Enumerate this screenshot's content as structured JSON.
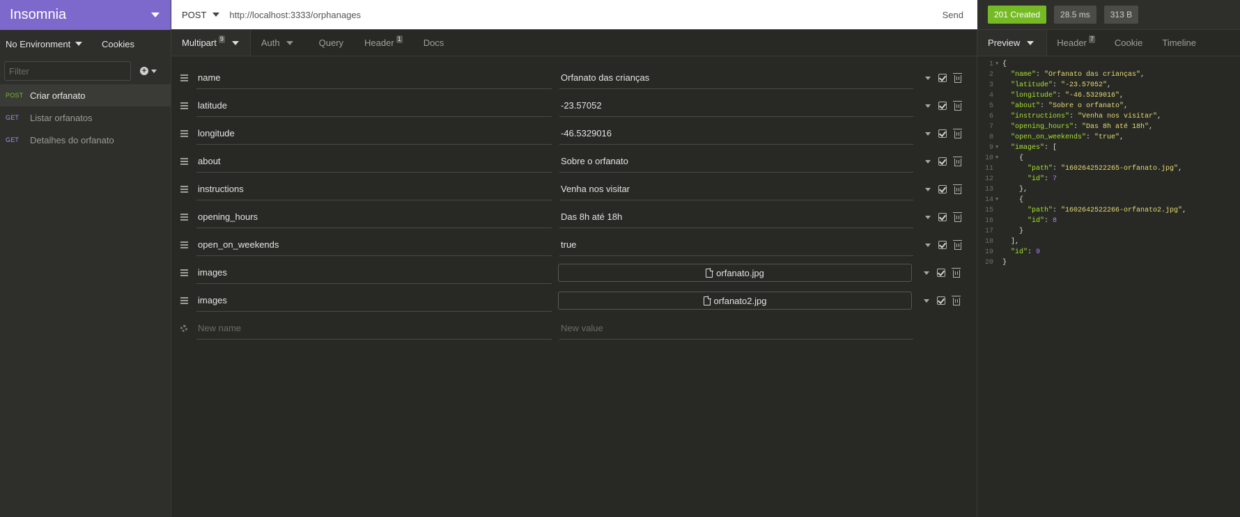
{
  "sidebar": {
    "workspace": "Insomnia",
    "environment": "No Environment",
    "cookies": "Cookies",
    "filter_placeholder": "Filter",
    "requests": [
      {
        "method": "POST",
        "name": "Criar orfanato",
        "active": true
      },
      {
        "method": "GET",
        "name": "Listar orfanatos",
        "active": false
      },
      {
        "method": "GET",
        "name": "Detalhes do orfanato",
        "active": false
      }
    ]
  },
  "urlbar": {
    "method": "POST",
    "url": "http://localhost:3333/orphanages",
    "send": "Send"
  },
  "request_tabs": {
    "body": {
      "label": "Multipart",
      "count": "9"
    },
    "auth": {
      "label": "Auth"
    },
    "query": {
      "label": "Query"
    },
    "header": {
      "label": "Header",
      "count": "1"
    },
    "docs": {
      "label": "Docs"
    }
  },
  "params": [
    {
      "name": "name",
      "value": "Orfanato das crianças"
    },
    {
      "name": "latitude",
      "value": "-23.57052"
    },
    {
      "name": "longitude",
      "value": "-46.5329016"
    },
    {
      "name": "about",
      "value": "Sobre o orfanato"
    },
    {
      "name": "instructions",
      "value": "Venha nos visitar"
    },
    {
      "name": "opening_hours",
      "value": "Das 8h até 18h"
    },
    {
      "name": "open_on_weekends",
      "value": "true"
    },
    {
      "name": "images",
      "file": "orfanato.jpg"
    },
    {
      "name": "images",
      "file": "orfanato2.jpg"
    }
  ],
  "new_param": {
    "name_placeholder": "New name",
    "value_placeholder": "New value"
  },
  "response": {
    "status": "201 Created",
    "time": "28.5 ms",
    "size": "313 B",
    "status_color": "#75ba24",
    "tabs": {
      "preview": {
        "label": "Preview"
      },
      "header": {
        "label": "Header",
        "count": "7"
      },
      "cookie": {
        "label": "Cookie"
      },
      "timeline": {
        "label": "Timeline"
      }
    },
    "body_lines": [
      {
        "n": "1",
        "fold": true,
        "indent": 0,
        "tokens": [
          [
            "pun",
            "{"
          ]
        ]
      },
      {
        "n": "2",
        "indent": 1,
        "tokens": [
          [
            "key",
            "\"name\""
          ],
          [
            "pun",
            ": "
          ],
          [
            "str",
            "\"Orfanato das crianças\""
          ],
          [
            "pun",
            ","
          ]
        ]
      },
      {
        "n": "3",
        "indent": 1,
        "tokens": [
          [
            "key",
            "\"latitude\""
          ],
          [
            "pun",
            ": "
          ],
          [
            "str",
            "\"-23.57052\""
          ],
          [
            "pun",
            ","
          ]
        ]
      },
      {
        "n": "4",
        "indent": 1,
        "tokens": [
          [
            "key",
            "\"longitude\""
          ],
          [
            "pun",
            ": "
          ],
          [
            "str",
            "\"-46.5329016\""
          ],
          [
            "pun",
            ","
          ]
        ]
      },
      {
        "n": "5",
        "indent": 1,
        "tokens": [
          [
            "key",
            "\"about\""
          ],
          [
            "pun",
            ": "
          ],
          [
            "str",
            "\"Sobre o orfanato\""
          ],
          [
            "pun",
            ","
          ]
        ]
      },
      {
        "n": "6",
        "indent": 1,
        "tokens": [
          [
            "key",
            "\"instructions\""
          ],
          [
            "pun",
            ": "
          ],
          [
            "str",
            "\"Venha nos visitar\""
          ],
          [
            "pun",
            ","
          ]
        ]
      },
      {
        "n": "7",
        "indent": 1,
        "tokens": [
          [
            "key",
            "\"opening_hours\""
          ],
          [
            "pun",
            ": "
          ],
          [
            "str",
            "\"Das 8h até 18h\""
          ],
          [
            "pun",
            ","
          ]
        ]
      },
      {
        "n": "8",
        "indent": 1,
        "tokens": [
          [
            "key",
            "\"open_on_weekends\""
          ],
          [
            "pun",
            ": "
          ],
          [
            "str",
            "\"true\""
          ],
          [
            "pun",
            ","
          ]
        ]
      },
      {
        "n": "9",
        "fold": true,
        "indent": 1,
        "tokens": [
          [
            "key",
            "\"images\""
          ],
          [
            "pun",
            ": ["
          ]
        ]
      },
      {
        "n": "10",
        "fold": true,
        "indent": 2,
        "tokens": [
          [
            "pun",
            "{"
          ]
        ]
      },
      {
        "n": "11",
        "indent": 3,
        "tokens": [
          [
            "key",
            "\"path\""
          ],
          [
            "pun",
            ": "
          ],
          [
            "str",
            "\"1602642522265-orfanato.jpg\""
          ],
          [
            "pun",
            ","
          ]
        ]
      },
      {
        "n": "12",
        "indent": 3,
        "tokens": [
          [
            "key",
            "\"id\""
          ],
          [
            "pun",
            ": "
          ],
          [
            "num",
            "7"
          ]
        ]
      },
      {
        "n": "13",
        "indent": 2,
        "tokens": [
          [
            "pun",
            "},"
          ]
        ]
      },
      {
        "n": "14",
        "fold": true,
        "indent": 2,
        "tokens": [
          [
            "pun",
            "{"
          ]
        ]
      },
      {
        "n": "15",
        "indent": 3,
        "tokens": [
          [
            "key",
            "\"path\""
          ],
          [
            "pun",
            ": "
          ],
          [
            "str",
            "\"1602642522266-orfanato2.jpg\""
          ],
          [
            "pun",
            ","
          ]
        ]
      },
      {
        "n": "16",
        "indent": 3,
        "tokens": [
          [
            "key",
            "\"id\""
          ],
          [
            "pun",
            ": "
          ],
          [
            "num",
            "8"
          ]
        ]
      },
      {
        "n": "17",
        "indent": 2,
        "tokens": [
          [
            "pun",
            "}"
          ]
        ]
      },
      {
        "n": "18",
        "indent": 1,
        "tokens": [
          [
            "pun",
            "],"
          ]
        ]
      },
      {
        "n": "19",
        "indent": 1,
        "tokens": [
          [
            "key",
            "\"id\""
          ],
          [
            "pun",
            ": "
          ],
          [
            "num",
            "9"
          ]
        ]
      },
      {
        "n": "20",
        "indent": 0,
        "tokens": [
          [
            "pun",
            "}"
          ]
        ]
      }
    ]
  }
}
